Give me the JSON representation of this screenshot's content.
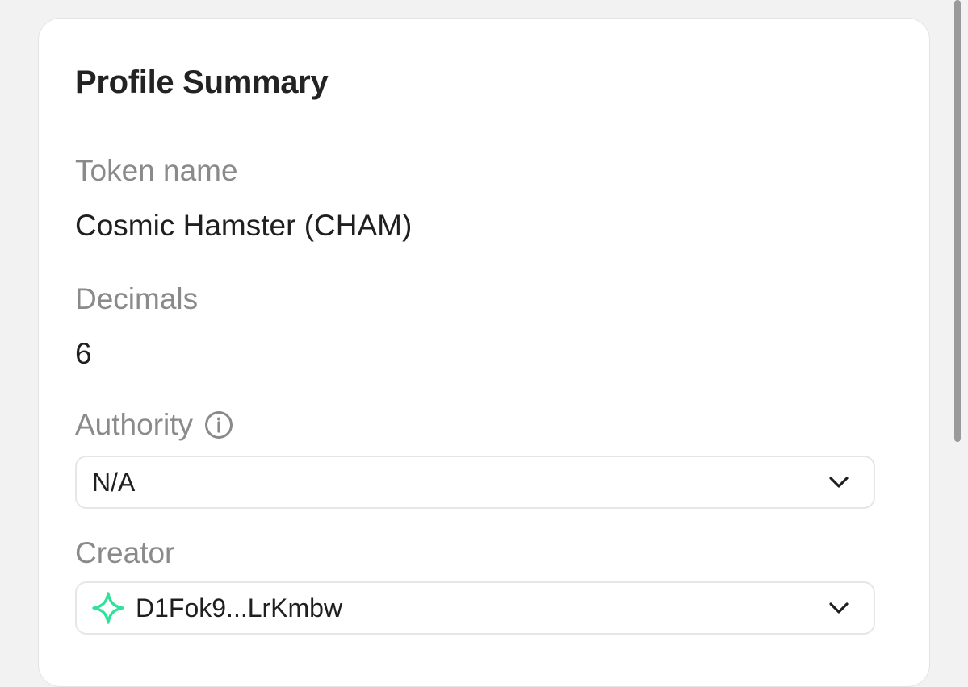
{
  "card": {
    "title": "Profile Summary",
    "token_name_label": "Token name",
    "token_name_value": "Cosmic Hamster (CHAM)",
    "decimals_label": "Decimals",
    "decimals_value": "6",
    "authority_label": "Authority",
    "authority_value": "N/A",
    "creator_label": "Creator",
    "creator_value": "D1Fok9...LrKmbw"
  },
  "icons": {
    "info": "info-circle-icon",
    "creator": "sparkle-icon",
    "chevron": "chevron-down-icon"
  },
  "colors": {
    "background": "#f2f2f2",
    "card": "#ffffff",
    "label": "#8a8a8a",
    "text": "#1f1f1f",
    "accent": "#2ee29a"
  }
}
